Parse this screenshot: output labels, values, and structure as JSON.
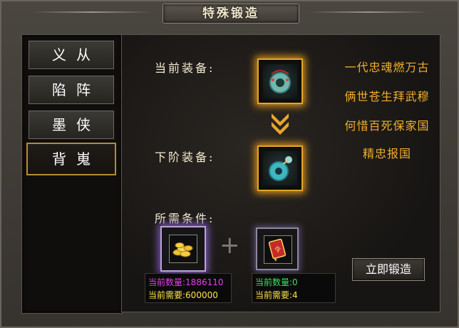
{
  "window": {
    "title": "特殊锻造"
  },
  "tabs": [
    {
      "label": "义从",
      "active": false
    },
    {
      "label": "陷阵",
      "active": false
    },
    {
      "label": "墨侠",
      "active": false
    },
    {
      "label": "背嵬",
      "active": true
    }
  ],
  "equipment": {
    "current_label": "当前装备:",
    "next_label": "下阶装备:",
    "current_icon": "jade-pendant-icon",
    "next_icon": "jade-pendant-upgraded-icon"
  },
  "poem": {
    "lines": [
      "一代忠魂燃万古",
      "俩世苍生拜武穆",
      "何惜百死保家国",
      "精忠报国"
    ]
  },
  "requirements": {
    "label": "所需条件:",
    "item1": {
      "icon": "gold-coins-icon",
      "current_label": "当前数量:",
      "current_value": "1886110",
      "need_label": "当前需要:",
      "need_value": "600000"
    },
    "item2": {
      "icon": "red-token-icon",
      "current_label": "当前数量:",
      "current_value": "0",
      "need_label": "当前需要:",
      "need_value": "4"
    },
    "plus": "+"
  },
  "forge_button": {
    "label": "立即锻造"
  },
  "colors": {
    "gold_border": "#e0a52a",
    "poem_text": "#f2ae2c",
    "magenta_text": "#e040e8",
    "yellow_text": "#ffe24a",
    "green_text": "#38e060"
  }
}
